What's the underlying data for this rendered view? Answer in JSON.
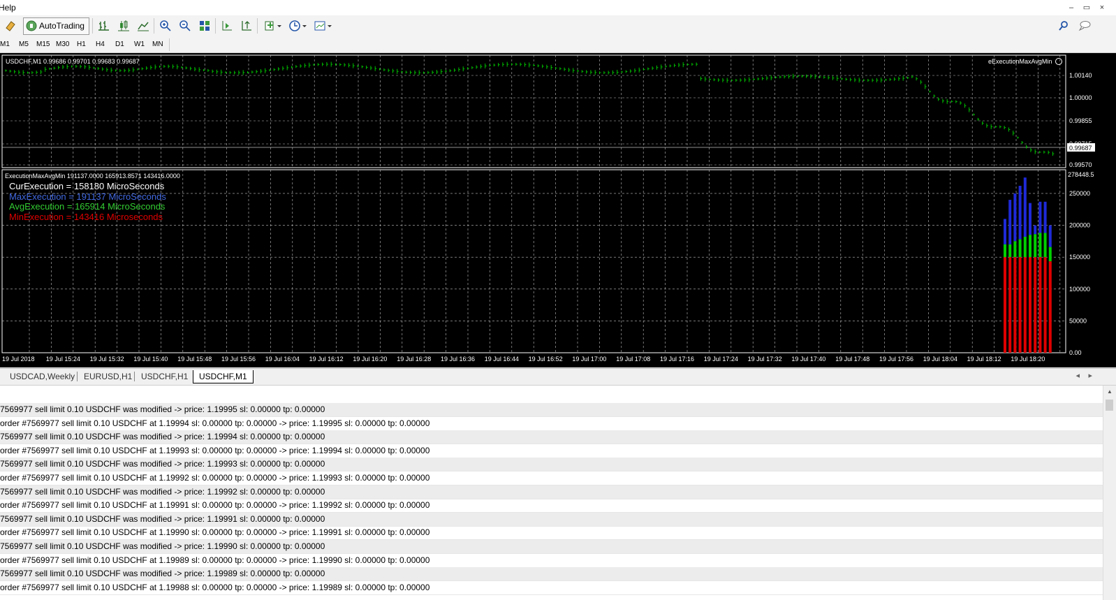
{
  "menu": {
    "help_label": "Help"
  },
  "window_buttons": [
    "–",
    "▭",
    "×"
  ],
  "toolbar": {
    "autotrading_label": "AutoTrading"
  },
  "timeframes": [
    "M1",
    "M5",
    "M15",
    "M30",
    "H1",
    "H4",
    "D1",
    "W1",
    "MN"
  ],
  "chart": {
    "header": "USDCHF,M1  0.99686 0.99701 0.99683 0.99687",
    "indicator_name_top": "eExecutionMaxAvgMin",
    "price_labels": [
      "1.00140",
      "1.00000",
      "0.99855",
      "0.99715",
      "0.99570"
    ],
    "current_price": "0.99687",
    "indicator_header": "ExecutionMaxAvgMin 191137.0000 165913.8571 143416.0000",
    "indicator_max_label": "278448.5",
    "indicator_labels": [
      "250000",
      "200000",
      "150000",
      "100000",
      "50000",
      "0.00"
    ],
    "stats": [
      {
        "text": "CurExecution  = 158180  MicroSeconds",
        "color": "#ffffff"
      },
      {
        "text": "MaxExecution = 191137  MicroSeconds",
        "color": "#4169e1"
      },
      {
        "text": "AvgExecution = 165914  MicroSeconds",
        "color": "#32cd32"
      },
      {
        "text": "MinExecution  = 143416  Microseconds",
        "color": "#e00000"
      }
    ],
    "time_labels": [
      "19 Jul 2018",
      "19 Jul 15:24",
      "19 Jul 15:32",
      "19 Jul 15:40",
      "19 Jul 15:48",
      "19 Jul 15:56",
      "19 Jul 16:04",
      "19 Jul 16:12",
      "19 Jul 16:20",
      "19 Jul 16:28",
      "19 Jul 16:36",
      "19 Jul 16:44",
      "19 Jul 16:52",
      "19 Jul 17:00",
      "19 Jul 17:08",
      "19 Jul 17:16",
      "19 Jul 17:24",
      "19 Jul 17:32",
      "19 Jul 17:40",
      "19 Jul 17:48",
      "19 Jul 17:56",
      "19 Jul 18:04",
      "19 Jul 18:12",
      "19 Jul 18:20"
    ],
    "colors": {
      "background": "#000000",
      "price": "#00c000",
      "grid": "#c0c0c0",
      "max": "#1e2ad8",
      "avg": "#00d000",
      "min": "#e00000"
    }
  },
  "chart_data": {
    "type": "bar",
    "title": "ExecutionMaxAvgMin",
    "ylim": [
      0,
      278448.5
    ],
    "series": [
      {
        "name": "MaxExecution",
        "values": [
          210000,
          240000,
          250000,
          262000,
          275000,
          235000,
          200000,
          237000,
          237000,
          200000
        ]
      },
      {
        "name": "AvgExecution",
        "values": [
          170000,
          170000,
          175000,
          178000,
          182000,
          185000,
          186000,
          188000,
          188000,
          165914
        ]
      },
      {
        "name": "MinExecution",
        "values": [
          150000,
          150000,
          150000,
          150000,
          150000,
          150000,
          150000,
          150000,
          150000,
          143416
        ]
      }
    ]
  },
  "tabs": [
    {
      "label": "USDCAD,Weekly",
      "active": false
    },
    {
      "label": "EURUSD,H1",
      "active": false
    },
    {
      "label": "USDCHF,H1",
      "active": false
    },
    {
      "label": "USDCHF,M1",
      "active": true
    }
  ],
  "journal": [
    "7569977 sell limit 0.10 USDCHF was modified -> price: 1.19995 sl: 0.00000 tp: 0.00000",
    "order #7569977 sell limit 0.10 USDCHF at 1.19994 sl: 0.00000 tp: 0.00000 -> price: 1.19995 sl: 0.00000 tp: 0.00000",
    "7569977 sell limit 0.10 USDCHF was modified -> price: 1.19994 sl: 0.00000 tp: 0.00000",
    "order #7569977 sell limit 0.10 USDCHF at 1.19993 sl: 0.00000 tp: 0.00000 -> price: 1.19994 sl: 0.00000 tp: 0.00000",
    "7569977 sell limit 0.10 USDCHF was modified -> price: 1.19993 sl: 0.00000 tp: 0.00000",
    "order #7569977 sell limit 0.10 USDCHF at 1.19992 sl: 0.00000 tp: 0.00000 -> price: 1.19993 sl: 0.00000 tp: 0.00000",
    "7569977 sell limit 0.10 USDCHF was modified -> price: 1.19992 sl: 0.00000 tp: 0.00000",
    "order #7569977 sell limit 0.10 USDCHF at 1.19991 sl: 0.00000 tp: 0.00000 -> price: 1.19992 sl: 0.00000 tp: 0.00000",
    "7569977 sell limit 0.10 USDCHF was modified -> price: 1.19991 sl: 0.00000 tp: 0.00000",
    "order #7569977 sell limit 0.10 USDCHF at 1.19990 sl: 0.00000 tp: 0.00000 -> price: 1.19991 sl: 0.00000 tp: 0.00000",
    "7569977 sell limit 0.10 USDCHF was modified -> price: 1.19990 sl: 0.00000 tp: 0.00000",
    "order #7569977 sell limit 0.10 USDCHF at 1.19989 sl: 0.00000 tp: 0.00000 -> price: 1.19990 sl: 0.00000 tp: 0.00000",
    "7569977 sell limit 0.10 USDCHF was modified -> price: 1.19989 sl: 0.00000 tp: 0.00000",
    "order #7569977 sell limit 0.10 USDCHF at 1.19988 sl: 0.00000 tp: 0.00000 -> price: 1.19989 sl: 0.00000 tp: 0.00000"
  ]
}
